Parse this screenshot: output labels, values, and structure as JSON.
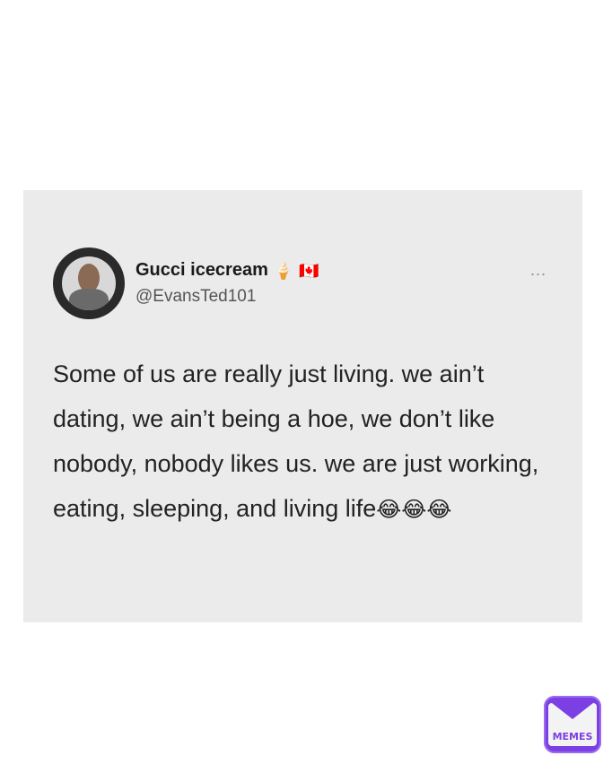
{
  "tweet": {
    "display_name": "Gucci icecream",
    "name_emojis": [
      "🍦",
      "🇨🇦"
    ],
    "handle": "@EvansTed101",
    "more_icon": "...",
    "text": "Some of us are really just living. we ain’t dating, we ain’t being a hoe, we don’t like nobody, nobody likes us. we are just working, eating, sleeping, and living life",
    "trailing_emoji": "😂😂😂"
  },
  "watermark": {
    "label": "MEMES",
    "icon": "memes-logo-icon",
    "color": "#7b3fe4"
  }
}
